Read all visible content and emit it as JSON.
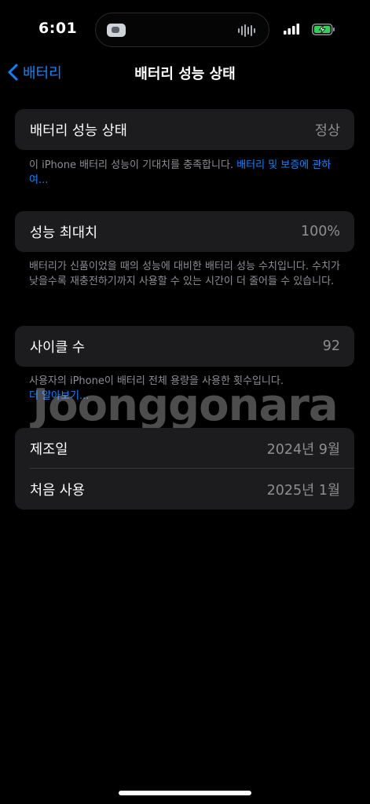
{
  "status_bar": {
    "time": "6:01",
    "icons": [
      "camera-icon",
      "waveform-icon",
      "signal-icon",
      "wifi-icon",
      "battery-charging-icon"
    ]
  },
  "nav": {
    "back_label": "배터리",
    "title": "배터리 성능 상태"
  },
  "health": {
    "label": "배터리 성능 상태",
    "value": "정상",
    "note_text": "이 iPhone 배터리 성능이 기대치를 충족합니다.",
    "note_link": "배터리 및 보증에 관하여..."
  },
  "capacity": {
    "label": "성능 최대치",
    "value": "100%",
    "note_text": "배터리가 신품이었을 때의 성능에 대비한 배터리 성능 수치입니다. 수치가 낮을수록 재충전하기까지 사용할 수 있는 시간이 더 줄어들 수 있습니다."
  },
  "cycle": {
    "label": "사이클 수",
    "value": "92",
    "note_text": "사용자의 iPhone이 배터리 전체 용량을 사용한 횟수입니다.",
    "note_link": "더 알아보기..."
  },
  "dates": {
    "manufactured_label": "제조일",
    "manufactured_value": "2024년 9월",
    "first_use_label": "처음 사용",
    "first_use_value": "2025년 1월"
  },
  "watermark": "Joonggonara",
  "colors": {
    "background": "#000000",
    "card": "#1c1c1e",
    "accent": "#0a84ff",
    "secondary_text": "#8e8e93",
    "battery_charge": "#30d158"
  }
}
